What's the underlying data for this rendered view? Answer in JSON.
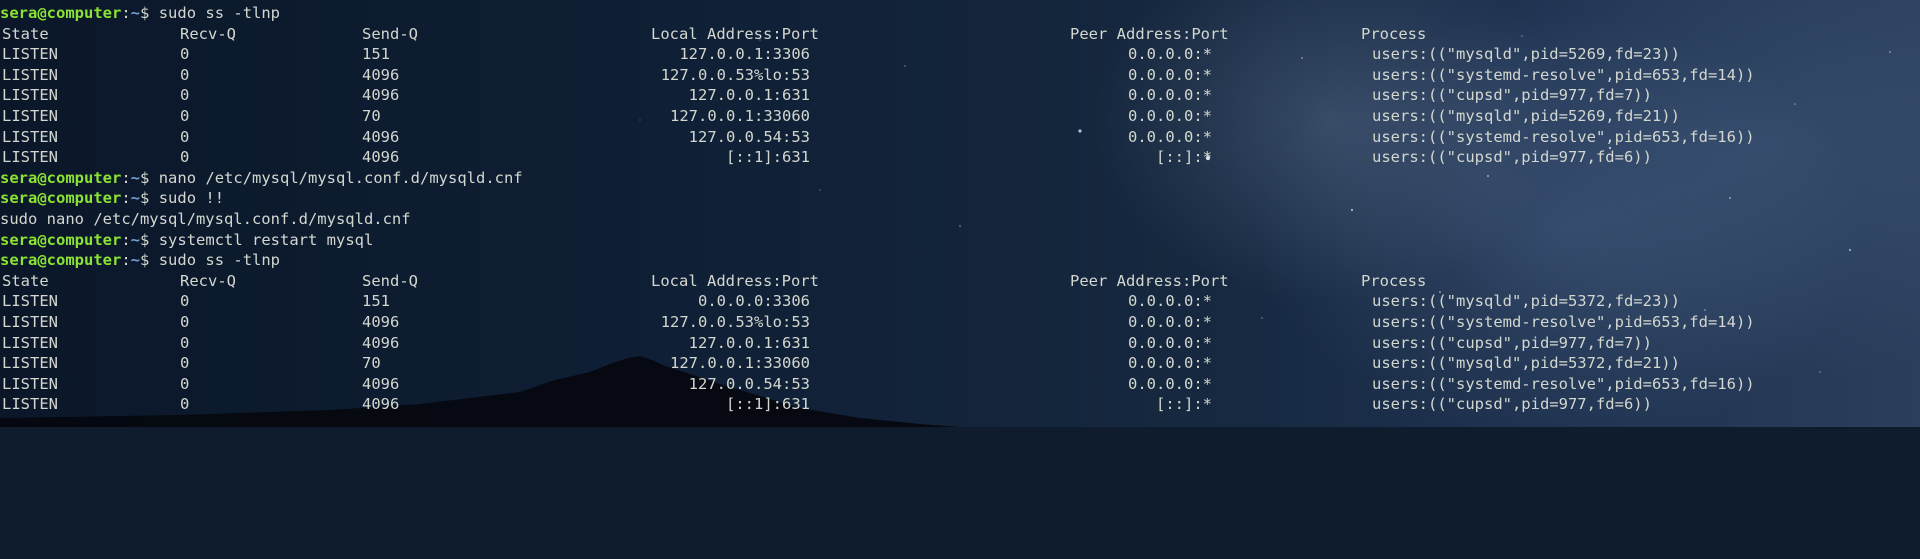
{
  "terminal": {
    "prompt": {
      "user_host": "sera@computer",
      "separator": ":",
      "path": "~",
      "symbol": "$"
    },
    "header": {
      "state": "State",
      "recv_q": "Recv-Q",
      "send_q": "Send-Q",
      "local": "Local Address:Port",
      "peer": "Peer Address:Port",
      "process": "Process"
    },
    "commands": {
      "c1": "sudo ss -tlnp",
      "c2": "nano /etc/mysql/mysql.conf.d/mysqld.cnf",
      "c3": "sudo !!",
      "c3_output": "sudo nano /etc/mysql/mysql.conf.d/mysqld.cnf",
      "c4": "systemctl restart mysql",
      "c5": "sudo ss -tlnp"
    },
    "block1": [
      {
        "state": "LISTEN",
        "recv": "0",
        "send": "151",
        "local": "127.0.0.1:3306",
        "peer": "0.0.0.0:*",
        "process": "users:((\"mysqld\",pid=5269,fd=23))"
      },
      {
        "state": "LISTEN",
        "recv": "0",
        "send": "4096",
        "local": "127.0.0.53%lo:53",
        "peer": "0.0.0.0:*",
        "process": "users:((\"systemd-resolve\",pid=653,fd=14))"
      },
      {
        "state": "LISTEN",
        "recv": "0",
        "send": "4096",
        "local": "127.0.0.1:631",
        "peer": "0.0.0.0:*",
        "process": "users:((\"cupsd\",pid=977,fd=7))"
      },
      {
        "state": "LISTEN",
        "recv": "0",
        "send": "70",
        "local": "127.0.0.1:33060",
        "peer": "0.0.0.0:*",
        "process": "users:((\"mysqld\",pid=5269,fd=21))"
      },
      {
        "state": "LISTEN",
        "recv": "0",
        "send": "4096",
        "local": "127.0.0.54:53",
        "peer": "0.0.0.0:*",
        "process": "users:((\"systemd-resolve\",pid=653,fd=16))"
      },
      {
        "state": "LISTEN",
        "recv": "0",
        "send": "4096",
        "local": "[::1]:631",
        "peer": "[::]:*",
        "process": "users:((\"cupsd\",pid=977,fd=6))"
      }
    ],
    "block2": [
      {
        "state": "LISTEN",
        "recv": "0",
        "send": "151",
        "local": "0.0.0.0:3306",
        "peer": "0.0.0.0:*",
        "process": "users:((\"mysqld\",pid=5372,fd=23))"
      },
      {
        "state": "LISTEN",
        "recv": "0",
        "send": "4096",
        "local": "127.0.0.53%lo:53",
        "peer": "0.0.0.0:*",
        "process": "users:((\"systemd-resolve\",pid=653,fd=14))"
      },
      {
        "state": "LISTEN",
        "recv": "0",
        "send": "4096",
        "local": "127.0.0.1:631",
        "peer": "0.0.0.0:*",
        "process": "users:((\"cupsd\",pid=977,fd=7))"
      },
      {
        "state": "LISTEN",
        "recv": "0",
        "send": "70",
        "local": "127.0.0.1:33060",
        "peer": "0.0.0.0:*",
        "process": "users:((\"mysqld\",pid=5372,fd=21))"
      },
      {
        "state": "LISTEN",
        "recv": "0",
        "send": "4096",
        "local": "127.0.0.54:53",
        "peer": "0.0.0.0:*",
        "process": "users:((\"systemd-resolve\",pid=653,fd=16))"
      },
      {
        "state": "LISTEN",
        "recv": "0",
        "send": "4096",
        "local": "[::1]:631",
        "peer": "[::]:*",
        "process": "users:((\"cupsd\",pid=977,fd=6))"
      }
    ]
  },
  "theme": {
    "prompt_user_color": "#8ae234",
    "prompt_path_color": "#729fcf",
    "text_color": "#d3d7cf",
    "background": "night-sky-milky-way"
  }
}
